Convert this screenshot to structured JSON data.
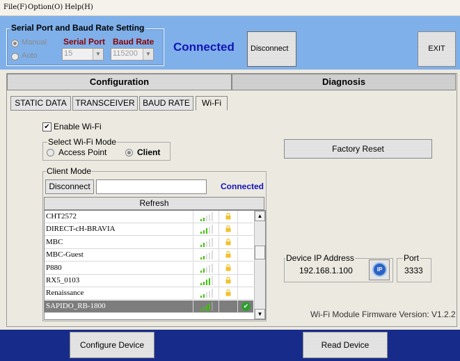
{
  "menu": {
    "file": "File(F)",
    "option": "Option(O)",
    "help": "Help(H)"
  },
  "serial": {
    "title": "Serial Port and Baud Rate Setting",
    "manual_label": "Manual",
    "auto_label": "Auto",
    "serial_port_label": "Serial Port",
    "baud_rate_label": "Baud Rate",
    "serial_port_value": "15",
    "baud_rate_value": "115200"
  },
  "status": {
    "connected": "Connected"
  },
  "buttons": {
    "disconnect_top": "Disconnect",
    "exit": "EXIT"
  },
  "main_tabs": {
    "configuration": "Configuration",
    "diagnosis": "Diagnosis"
  },
  "sub_tabs": [
    "STATIC DATA",
    "TRANSCEIVER",
    "BAUD RATE",
    "Wi-Fi"
  ],
  "wifi": {
    "enable_label": "Enable Wi-Fi",
    "mode_group": "Select Wi-Fi Mode",
    "access_point": "Access Point",
    "client": "Client",
    "client_mode_group": "Client Mode",
    "disconnect_label": "Disconnect",
    "ssid_input_value": "",
    "client_status": "Connected",
    "refresh_label": "Refresh",
    "networks": [
      {
        "name": "CHT2572",
        "signal": 2,
        "locked": true,
        "connected": false
      },
      {
        "name": "DIRECT-cH-BRAVIA",
        "signal": 3,
        "locked": true,
        "connected": false
      },
      {
        "name": "MBC",
        "signal": 2,
        "locked": true,
        "connected": false
      },
      {
        "name": "MBC-Guest",
        "signal": 2,
        "locked": true,
        "connected": false
      },
      {
        "name": "P880",
        "signal": 2,
        "locked": true,
        "connected": false
      },
      {
        "name": "RX5_0103",
        "signal": 4,
        "locked": true,
        "connected": false
      },
      {
        "name": "Renaissance",
        "signal": 2,
        "locked": true,
        "connected": false
      },
      {
        "name": "SAPIDO_RB-1800",
        "signal": 4,
        "locked": false,
        "connected": true
      }
    ],
    "factory_reset": "Factory Reset",
    "ip_group": "Device IP Address",
    "ip_value": "192.168.1.100",
    "port_group": "Port",
    "port_value": "3333",
    "ip_icon_text": "IP",
    "firmware": "Wi-Fi Module Firmware Version: V1.2.2"
  },
  "footer": {
    "configure": "Configure Device",
    "read": "Read Device"
  },
  "colors": {
    "top_band": "#7fb0ea",
    "bottom_band": "#172c8a",
    "connected_text": "#1313b5",
    "signal_green": "#3ec300",
    "lock_yellow": "#f2c12e"
  }
}
